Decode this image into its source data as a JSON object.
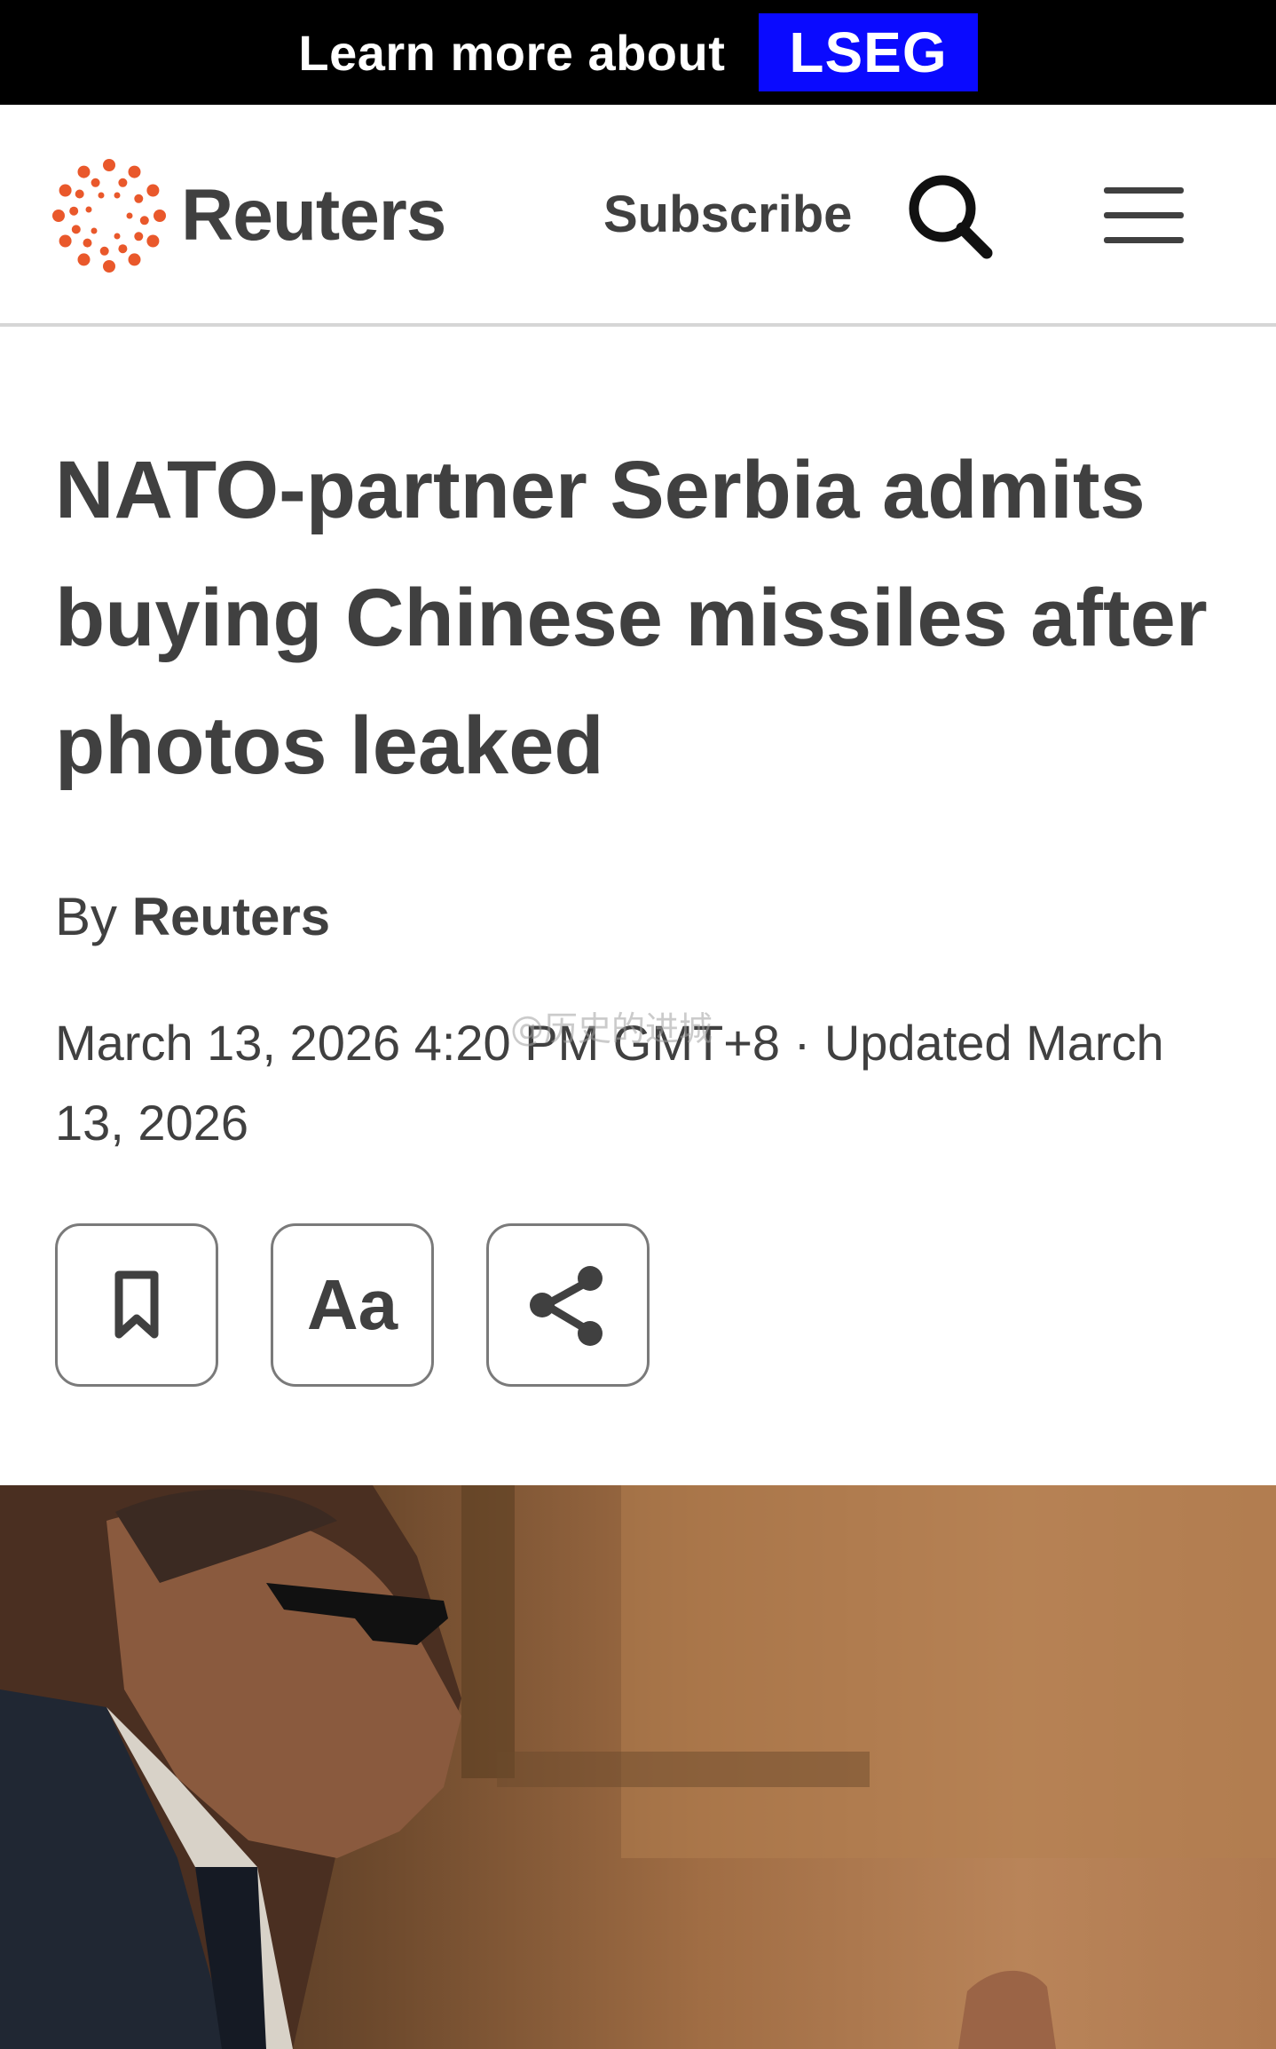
{
  "ad": {
    "text": "Learn more about",
    "brand": "LSEG",
    "brand_color": "#0a0aff"
  },
  "header": {
    "logo_text": "Reuters",
    "logo_color": "#e9582b",
    "subscribe_label": "Subscribe",
    "icons": {
      "search": "search-icon",
      "menu": "hamburger-menu-icon"
    }
  },
  "article": {
    "headline": "NATO-partner Serbia admits buying Chinese missiles after photos leaked",
    "byline_prefix": "By",
    "author": "Reuters",
    "dateline": "March 13, 2026 4:20 PM GMT+8 · Updated March 13, 2026",
    "watermark": "@历史的进城"
  },
  "actions": {
    "bookmark_icon": "bookmark-icon",
    "text_size_label": "Aa",
    "share_icon": "share-icon"
  }
}
